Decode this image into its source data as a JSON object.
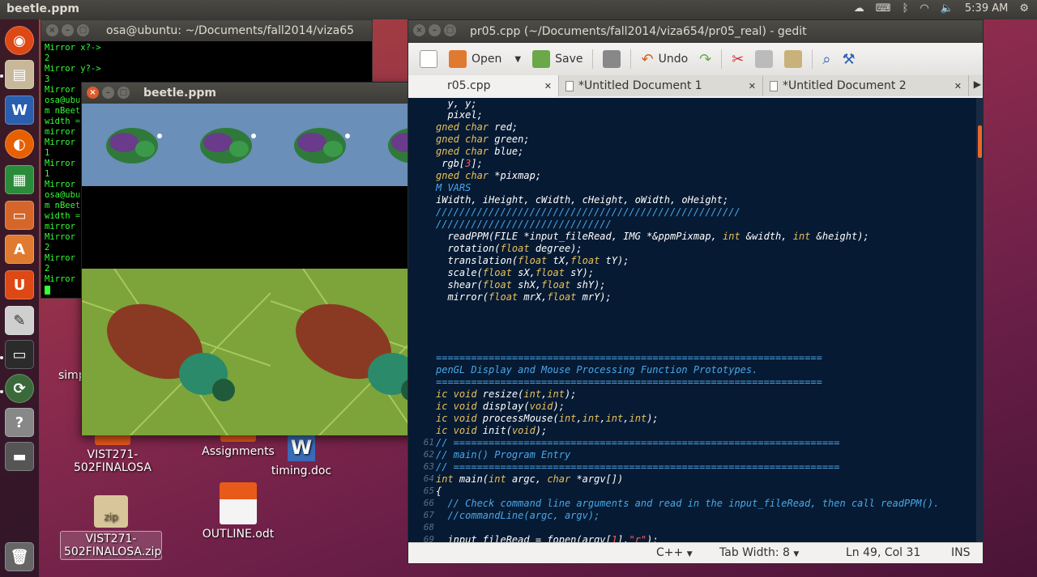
{
  "top_panel": {
    "title": "beetle.ppm",
    "time": "5:39 AM"
  },
  "terminal": {
    "title": "osa@ubuntu: ~/Documents/fall2014/viza65",
    "lines": [
      "Mirror x?->",
      "2",
      "Mirror y?->",
      "3",
      "Mirror",
      "osa@ubun",
      "m nBeet",
      "width =",
      "mirror",
      "Mirror",
      "1",
      "Mirror",
      "1",
      "Mirror",
      "osa@ubun",
      "m nBeet",
      "width =",
      "mirror",
      "Mirror",
      "2",
      "Mirror",
      "2",
      "Mirror"
    ]
  },
  "beetle_window": {
    "title": "beetle.ppm"
  },
  "desktop_icons": {
    "simp": "simp",
    "vist_folder": "VIST271-\n502FINALOSA",
    "assignments": "Assignments",
    "timing": "timing.doc",
    "zip_label": "zip",
    "vist_zip": "VIST271-\n502FINALOSA.zip",
    "outline": "OUTLINE.odt"
  },
  "gedit": {
    "title": "pr05.cpp (~/Documents/fall2014/viza654/pr05_real) - gedit",
    "toolbar": {
      "open": "Open",
      "save": "Save",
      "undo": "Undo"
    },
    "tabs": [
      {
        "label": "r05.cpp",
        "close": "✕"
      },
      {
        "label": "*Untitled Document 1",
        "close": "✕"
      },
      {
        "label": "*Untitled Document 2",
        "close": "✕"
      }
    ],
    "status": {
      "language": "C++",
      "tab_width": "Tab Width:  8",
      "position": "Ln 49, Col 31",
      "mode": "INS"
    }
  },
  "colors": {
    "accent": "#e05a2b",
    "editor_bg": "#061a33",
    "terminal_fg": "#33ff33"
  }
}
